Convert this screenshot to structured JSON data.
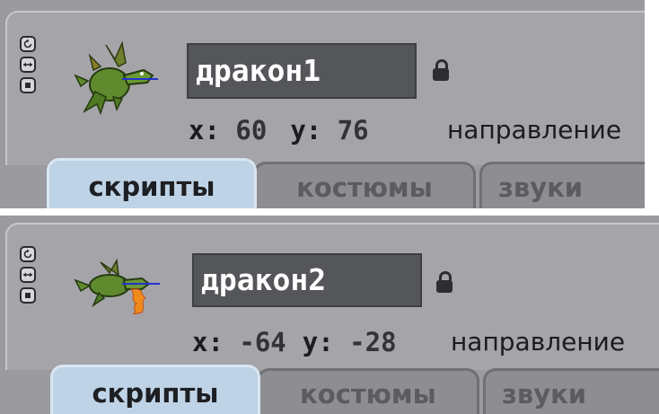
{
  "sprites": [
    {
      "name": "дракон1",
      "x_label": "x:",
      "x_value": "60",
      "y_label": "y:",
      "y_value": "76",
      "direction_label": "направление",
      "tabs": [
        {
          "label": "скрипты",
          "active": true
        },
        {
          "label": "костюмы",
          "active": false
        },
        {
          "label": "звуки",
          "active": false
        }
      ]
    },
    {
      "name": "дракон2",
      "x_label": "x:",
      "x_value": "-64",
      "y_label": "y:",
      "y_value": "-28",
      "direction_label": "направление",
      "tabs": [
        {
          "label": "скрипты",
          "active": true
        },
        {
          "label": "костюмы",
          "active": false
        },
        {
          "label": "звуки",
          "active": false
        }
      ]
    }
  ],
  "icons": {
    "rotation_style_buttons": [
      "rotate-all-around-icon",
      "left-right-flip-icon",
      "dont-rotate-icon"
    ],
    "lock": "lock-icon",
    "thumbnail": "dragon-sprite-icon"
  },
  "colors": {
    "panel_bg": "#9a9a9f",
    "name_field_bg": "#54565a",
    "active_tab": "#bfd3e6",
    "inactive_tab": "#8d8d92"
  }
}
